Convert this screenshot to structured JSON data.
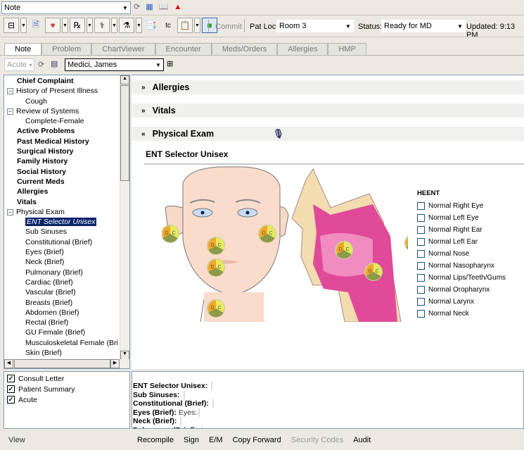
{
  "top": {
    "note_select": "Note",
    "icons": [
      "refresh-icon",
      "grid-icon",
      "book-icon",
      "alert-icon"
    ]
  },
  "toolbar": {
    "commit": "Commit",
    "pat_loc_label": "Pat Loc:",
    "pat_loc_value": "Room 3",
    "status_label": "Status:",
    "status_value": "Ready for MD",
    "updated": "Updated: 9:13 PM"
  },
  "tabs": [
    {
      "label": "Note",
      "active": true
    },
    {
      "label": "Problem"
    },
    {
      "label": "ChartViewer"
    },
    {
      "label": "Encounter"
    },
    {
      "label": "Meds/Orders"
    },
    {
      "label": "Allergies"
    },
    {
      "label": "HMP"
    }
  ],
  "filter": {
    "acute": "Acute",
    "patient": "Medici, James"
  },
  "tree": [
    {
      "label": "Chief Complaint",
      "bold": true,
      "level": 0
    },
    {
      "label": "History of Present Illness",
      "level": 0,
      "exp": "−"
    },
    {
      "label": "Cough",
      "level": 1
    },
    {
      "label": "Review of Systems",
      "level": 0,
      "exp": "−"
    },
    {
      "label": "Complete-Female",
      "level": 1
    },
    {
      "label": "Active Problems",
      "bold": true,
      "level": 0
    },
    {
      "label": "Past Medical History",
      "bold": true,
      "level": 0
    },
    {
      "label": "Surgical History",
      "bold": true,
      "level": 0
    },
    {
      "label": "Family History",
      "bold": true,
      "level": 0
    },
    {
      "label": "Social History",
      "bold": true,
      "level": 0
    },
    {
      "label": "Current Meds",
      "bold": true,
      "level": 0
    },
    {
      "label": "Allergies",
      "bold": true,
      "level": 0
    },
    {
      "label": "Vitals",
      "bold": true,
      "level": 0
    },
    {
      "label": "Physical Exam",
      "level": 0,
      "exp": "−"
    },
    {
      "label": "ENT Selector Unisex",
      "level": 1,
      "selected": true
    },
    {
      "label": "Sub Sinuses",
      "level": 1
    },
    {
      "label": "Constitutional (Brief)",
      "level": 1
    },
    {
      "label": "Eyes (Brief)",
      "level": 1
    },
    {
      "label": "Neck (Brief)",
      "level": 1
    },
    {
      "label": "Pulmonary (Brief)",
      "level": 1
    },
    {
      "label": "Cardiac (Brief)",
      "level": 1
    },
    {
      "label": "Vascular (Brief)",
      "level": 1
    },
    {
      "label": "Breasts (Brief)",
      "level": 1
    },
    {
      "label": "Abdomen (Brief)",
      "level": 1
    },
    {
      "label": "Rectal (Brief)",
      "level": 1
    },
    {
      "label": "GU Female (Brief)",
      "level": 1
    },
    {
      "label": "Musculoskeletal Female (Bri",
      "level": 1
    },
    {
      "label": "Skin (Brief)",
      "level": 1
    }
  ],
  "documents": [
    {
      "label": "Consult Letter",
      "checked": true
    },
    {
      "label": "Patient Summary",
      "checked": true
    },
    {
      "label": "Acute",
      "checked": true
    }
  ],
  "sections": {
    "allergies": "Allergies",
    "vitals": "Vitals",
    "physical_exam": "Physical Exam"
  },
  "ent": {
    "title": "ENT Selector Unisex",
    "heent": "HEENT",
    "badge_letters": [
      "D",
      "C"
    ],
    "items": [
      "Normal Right Eye",
      "Normal Left Eye",
      "Normal Right Ear",
      "Normal Left Ear",
      "Normal Nose",
      "Normal Nasopharynx",
      "Normal Lips/Teeth/Gums",
      "Normal Oropharynx",
      "Normal Larynx",
      "Normal Neck"
    ]
  },
  "preview": [
    {
      "label": "ENT Selector Unisex:",
      "value": ""
    },
    {
      "label": "Sub Sinuses:",
      "value": ""
    },
    {
      "label": "Constitutional (Brief):",
      "value": ""
    },
    {
      "label": "Eyes (Brief):",
      "value": "Eyes:"
    },
    {
      "label": "Neck (Brief):",
      "value": ""
    },
    {
      "label": "Pulmonary (Brief):",
      "value": ""
    }
  ],
  "bottom": {
    "view": "View",
    "actions": [
      {
        "label": "Recompile"
      },
      {
        "label": "Sign"
      },
      {
        "label": "E/M"
      },
      {
        "label": "Copy Forward"
      },
      {
        "label": "Security Codes",
        "disabled": true
      },
      {
        "label": "Audit"
      }
    ]
  }
}
